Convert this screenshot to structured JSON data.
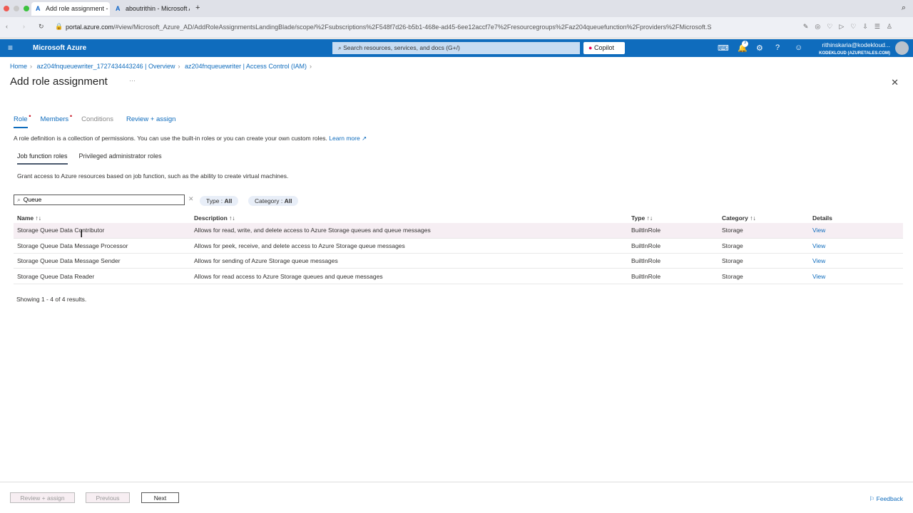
{
  "browser": {
    "tabs": [
      {
        "title": "Add role assignment - M"
      },
      {
        "title": "aboutrithin - Microsoft A"
      }
    ],
    "new_tab": "+",
    "url_host": "portal.azure.com",
    "url_path": "/#view/Microsoft_Azure_AD/AddRoleAssignmentsLandingBlade/scope/%2Fsubscriptions%2F548f7d26-b5b1-468e-ad45-6ee12accf7e7%2Fresourcegroups%2Faz204queuefunction%2Fproviders%2FMicrosoft.S"
  },
  "portal": {
    "brand": "Microsoft Azure",
    "search_placeholder": "Search resources, services, and docs (G+/)",
    "copilot": "Copilot",
    "notifications": "3",
    "account_email": "rithinskaria@kodekloud...",
    "account_tenant": "KODEKLOUD (AZURETALES.COM)"
  },
  "breadcrumb": [
    "Home",
    "az204fnqueuewriter_1727434443246 | Overview",
    "az204fnqueuewriter | Access Control (IAM)"
  ],
  "page_title": "Add role assignment",
  "steps": [
    "Role",
    "Members",
    "Conditions",
    "Review + assign"
  ],
  "intro": "A role definition is a collection of permissions. You can use the built-in roles or you can create your own custom roles.",
  "learn_more": "Learn more",
  "subtabs": [
    "Job function roles",
    "Privileged administrator roles"
  ],
  "subtab_desc": "Grant access to Azure resources based on job function, such as the ability to create virtual machines.",
  "search_value": "Queue",
  "filters": {
    "type_label": "Type : ",
    "type_value": "All",
    "category_label": "Category : ",
    "category_value": "All"
  },
  "columns": [
    "Name ↑↓",
    "Description ↑↓",
    "Type ↑↓",
    "Category ↑↓",
    "Details"
  ],
  "rows": [
    {
      "name": "Storage Queue Data Contributor",
      "desc": "Allows for read, write, and delete access to Azure Storage queues and queue messages",
      "type": "BuiltInRole",
      "category": "Storage",
      "details": "View"
    },
    {
      "name": "Storage Queue Data Message Processor",
      "desc": "Allows for peek, receive, and delete access to Azure Storage queue messages",
      "type": "BuiltInRole",
      "category": "Storage",
      "details": "View"
    },
    {
      "name": "Storage Queue Data Message Sender",
      "desc": "Allows for sending of Azure Storage queue messages",
      "type": "BuiltInRole",
      "category": "Storage",
      "details": "View"
    },
    {
      "name": "Storage Queue Data Reader",
      "desc": "Allows for read access to Azure Storage queues and queue messages",
      "type": "BuiltInRole",
      "category": "Storage",
      "details": "View"
    }
  ],
  "showing": "Showing 1 - 4 of 4 results.",
  "footer": {
    "review": "Review + assign",
    "previous": "Previous",
    "next": "Next",
    "feedback": "Feedback"
  }
}
